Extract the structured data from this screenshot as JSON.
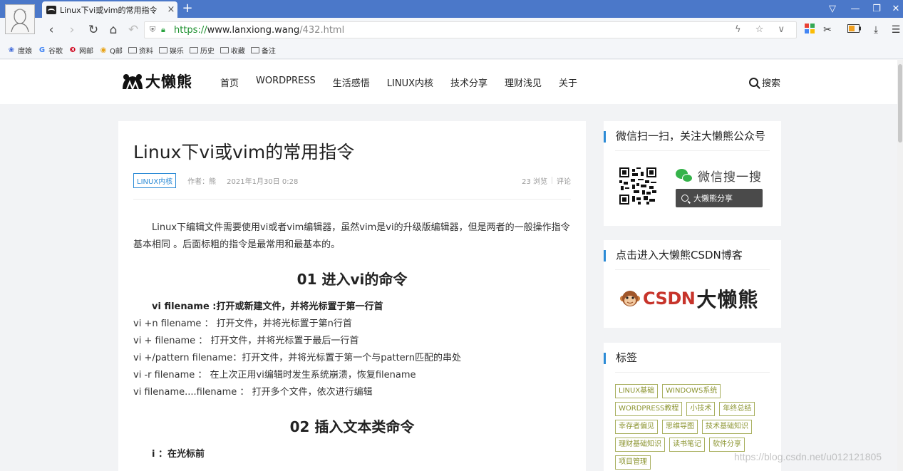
{
  "browser": {
    "tab_title": "Linux下vi或vim的常用指令",
    "tab_close": "×",
    "new_tab": "+",
    "window_controls": {
      "menu": "▽",
      "minimize": "—",
      "restore": "❐",
      "close": "✕"
    },
    "nav": {
      "back": "‹",
      "forward": "›",
      "reload": "↻",
      "home": "⌂",
      "undo": "↶"
    },
    "url": {
      "scheme": "https://",
      "host": "www.lanxiong.wang",
      "path": "/432.html"
    },
    "url_actions": "ϟ ☆ ∨",
    "tools": {
      "apps": "▦",
      "scissors": "✂",
      "battery": "▭",
      "download": "⤓",
      "menu": "☰"
    },
    "bookmarks": [
      {
        "label": "度娘",
        "icon": "paw-icon"
      },
      {
        "label": "谷歌",
        "icon": "g-icon"
      },
      {
        "label": "网邮",
        "icon": "mail-icon"
      },
      {
        "label": "Q邮",
        "icon": "chrome-icon"
      },
      {
        "label": "资料",
        "icon": "folder"
      },
      {
        "label": "娱乐",
        "icon": "folder"
      },
      {
        "label": "历史",
        "icon": "folder"
      },
      {
        "label": "收藏",
        "icon": "folder"
      },
      {
        "label": "备注",
        "icon": "folder"
      }
    ]
  },
  "site": {
    "logo_text": "大懒熊",
    "nav": [
      "首页",
      "WORDPRESS",
      "生活感悟",
      "LINUX内核",
      "技术分享",
      "理财浅见",
      "关于"
    ],
    "search_label": "搜索"
  },
  "article": {
    "title": "Linux下vi或vim的常用指令",
    "category": "LINUX内核",
    "author": "作者：熊",
    "date": "2021年1月30日 0:28",
    "views": "23 浏览",
    "comments": "评论",
    "intro": "Linux下编辑文件需要使用vi或者vim编辑器，虽然vim是vi的升级版编辑器，但是两者的一般操作指令基本相同 。后面标粗的指令是最常用和最基本的。",
    "section1": {
      "heading": "01 进入vi的命令",
      "bold": "vi filename :打开或新建文件，并将光标置于第一行首",
      "lines": [
        "vi +n filename ： 打开文件，并将光标置于第n行首",
        "vi + filename ： 打开文件，并将光标置于最后一行首",
        "vi +/pattern filename：打开文件，并将光标置于第一个与pattern匹配的串处",
        "vi -r filename ： 在上次正用vi编辑时发生系统崩溃，恢复filename",
        "vi filename....filename ： 打开多个文件，依次进行编辑"
      ]
    },
    "section2": {
      "heading": "02 插入文本类命令",
      "bold": "i ：在光标前"
    }
  },
  "sidebar": {
    "wechat_title": "微信扫一扫，关注大懒熊公众号",
    "wechat_search_label": "微信搜一搜",
    "wechat_search_query": "大懒熊分享",
    "csdn_title": "点击进入大懒熊CSDN博客",
    "csdn_brand": "CSDN",
    "csdn_name": "大懒熊",
    "tags_title": "标签",
    "tags": [
      "LINUX基础",
      "WINDOWS系统",
      "WORDPRESS教程",
      "小技术",
      "年终总结",
      "幸存者偏见",
      "思维导图",
      "技术基础知识",
      "理财基础知识",
      "读书笔记",
      "软件分享",
      "项目管理"
    ]
  },
  "watermark": "https://blog.csdn.net/u012121805",
  "colors": {
    "titlebar": "#4b78c9",
    "accent": "#2c8bd6",
    "tag": "#8c9531",
    "secure": "#1a8f2c"
  }
}
